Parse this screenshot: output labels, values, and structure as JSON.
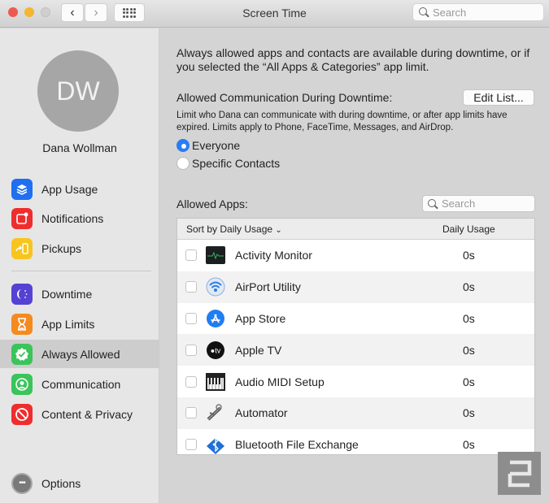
{
  "window": {
    "title": "Screen Time",
    "search_placeholder": "Search"
  },
  "sidebar": {
    "avatar_initials": "DW",
    "user_name": "Dana Wollman",
    "items": [
      {
        "label": "App Usage",
        "icon": "layers-icon",
        "color": "#1f6ff0"
      },
      {
        "label": "Notifications",
        "icon": "notification-badge-icon",
        "color": "#ef2d2d"
      },
      {
        "label": "Pickups",
        "icon": "pickup-phone-icon",
        "color": "#f7c51d"
      },
      {
        "label": "Downtime",
        "icon": "downtime-moon-icon",
        "color": "#5542d4"
      },
      {
        "label": "App Limits",
        "icon": "hourglass-icon",
        "color": "#f58a1f"
      },
      {
        "label": "Always Allowed",
        "icon": "checkmark-badge-icon",
        "color": "#3ac45a",
        "selected": true
      },
      {
        "label": "Communication",
        "icon": "person-circle-icon",
        "color": "#3ac45a"
      },
      {
        "label": "Content & Privacy",
        "icon": "prohibited-icon",
        "color": "#ef2d2d"
      }
    ],
    "options_label": "Options"
  },
  "main": {
    "intro": "Always allowed apps and contacts are available during downtime, or if you selected the “All Apps & Categories” app limit.",
    "comm_label": "Allowed Communication During Downtime:",
    "edit_list_label": "Edit List...",
    "comm_desc": "Limit who Dana can communicate with during downtime, or after app limits have expired. Limits apply to Phone, FaceTime, Messages, and AirDrop.",
    "radio_options": [
      {
        "label": "Everyone",
        "selected": true
      },
      {
        "label": "Specific Contacts",
        "selected": false
      }
    ],
    "apps_label": "Allowed Apps:",
    "apps_search_placeholder": "Search",
    "table": {
      "sort_header": "Sort by Daily Usage",
      "usage_header": "Daily Usage",
      "rows": [
        {
          "name": "Activity Monitor",
          "usage": "0s",
          "icon": "activity-monitor-icon",
          "checked": false
        },
        {
          "name": "AirPort Utility",
          "usage": "0s",
          "icon": "airport-utility-icon",
          "checked": false
        },
        {
          "name": "App Store",
          "usage": "0s",
          "icon": "app-store-icon",
          "checked": false
        },
        {
          "name": "Apple TV",
          "usage": "0s",
          "icon": "apple-tv-icon",
          "checked": false
        },
        {
          "name": "Audio MIDI Setup",
          "usage": "0s",
          "icon": "audio-midi-icon",
          "checked": false
        },
        {
          "name": "Automator",
          "usage": "0s",
          "icon": "automator-icon",
          "checked": false
        },
        {
          "name": "Bluetooth File Exchange",
          "usage": "0s",
          "icon": "bluetooth-file-exchange-icon",
          "checked": false
        }
      ]
    }
  },
  "watermark": {
    "icon": "engadget-logo-icon"
  }
}
